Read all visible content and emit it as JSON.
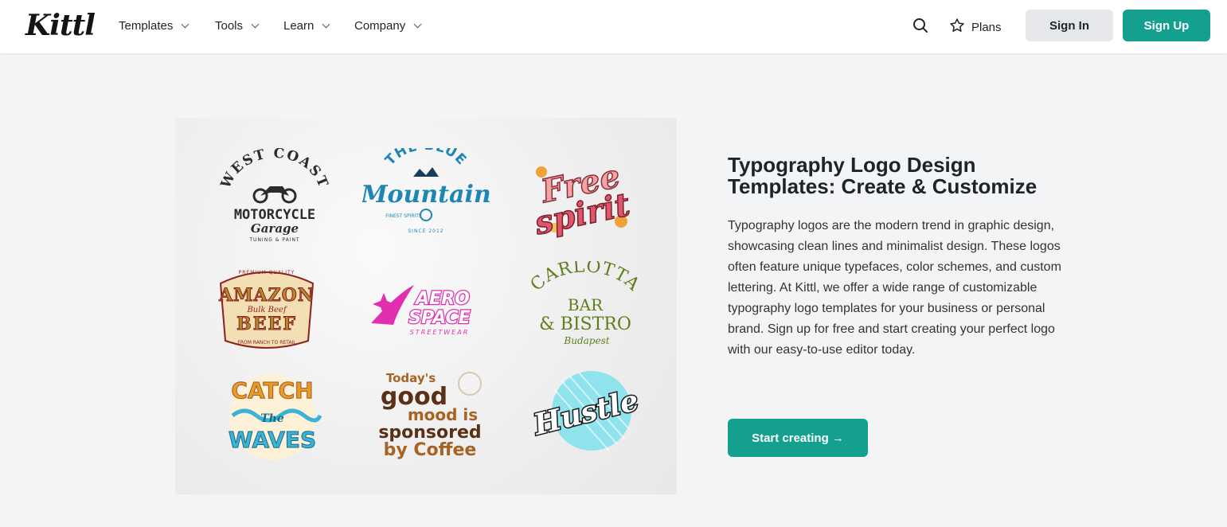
{
  "header": {
    "logo": "Kittl",
    "nav": [
      {
        "label": "Templates"
      },
      {
        "label": "Tools"
      },
      {
        "label": "Learn"
      },
      {
        "label": "Company"
      }
    ],
    "plans_label": "Plans",
    "signin_label": "Sign In",
    "signup_label": "Sign Up"
  },
  "showcase": {
    "logos": [
      {
        "icon": "west-coast-motorcycle-logo",
        "lines": [
          "WEST COAST",
          "MOTORCYCLE",
          "Garage",
          "TUNING & PAINT"
        ],
        "color": "#2b2b2b"
      },
      {
        "icon": "blue-mountain-logo",
        "lines": [
          "THE BLUE",
          "Mountain",
          "FINEST SPIRITS",
          "SINCE 2012"
        ],
        "color": "#1d86b5"
      },
      {
        "icon": "free-spirit-logo",
        "lines": [
          "Free",
          "spirit"
        ],
        "color": "#e0576b"
      },
      {
        "icon": "amazon-beef-logo",
        "lines": [
          "PREMIUM QUALITY",
          "AMAZON",
          "Bulk Beef",
          "BEEF",
          "FROM RANCH TO RETAIL"
        ],
        "color": "#8d1f1f"
      },
      {
        "icon": "aero-space-logo",
        "lines": [
          "AERO",
          "SPACE",
          "STREETWEAR"
        ],
        "color": "#e12fb0"
      },
      {
        "icon": "carlotta-bistro-logo",
        "lines": [
          "CARLOTTA",
          "BAR",
          "& BISTRO",
          "Budapest"
        ],
        "color": "#5f7f1c"
      },
      {
        "icon": "catch-the-waves-logo",
        "lines": [
          "CATCH",
          "The",
          "WAVES"
        ],
        "color": "#e89a2a"
      },
      {
        "icon": "good-mood-coffee-logo",
        "lines": [
          "Today's",
          "good",
          "mood is",
          "sponsored",
          "by Coffee"
        ],
        "color": "#5a3116"
      },
      {
        "icon": "hustle-logo",
        "lines": [
          "Hustle"
        ],
        "color": "#1b1b1b"
      }
    ]
  },
  "content": {
    "title": "Typography Logo Design Templates: Create & Customize",
    "description": "Typography logos are the modern trend in graphic design, showcasing clean lines and minimalist design. These logos often feature unique typefaces, color schemes, and custom lettering. At Kittl, we offer a wide range of customizable typography logo templates for your business or personal brand. Sign up for free and start creating your perfect logo with our easy-to-use editor today.",
    "cta_label": "Start creating →"
  },
  "colors": {
    "accent": "#14a08e",
    "background": "#f3f4f6"
  }
}
